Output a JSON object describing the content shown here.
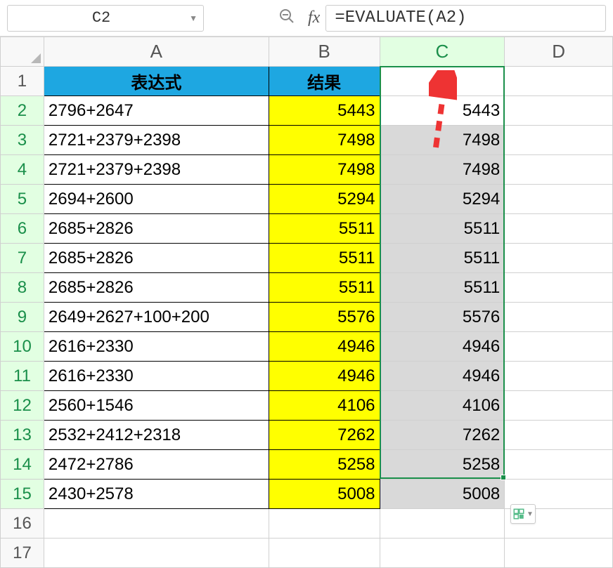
{
  "name_box": {
    "cell_reference": "C2"
  },
  "formula_bar": {
    "formula": "=EVALUATE(A2)"
  },
  "columns": [
    "A",
    "B",
    "C",
    "D"
  ],
  "headers": {
    "expression": "表达式",
    "result": "结果"
  },
  "rows": [
    {
      "n": 2,
      "expr": "2796+2647",
      "result": 5443,
      "c": 5443
    },
    {
      "n": 3,
      "expr": "2721+2379+2398",
      "result": 7498,
      "c": 7498
    },
    {
      "n": 4,
      "expr": "2721+2379+2398",
      "result": 7498,
      "c": 7498
    },
    {
      "n": 5,
      "expr": "2694+2600",
      "result": 5294,
      "c": 5294
    },
    {
      "n": 6,
      "expr": "2685+2826",
      "result": 5511,
      "c": 5511
    },
    {
      "n": 7,
      "expr": "2685+2826",
      "result": 5511,
      "c": 5511
    },
    {
      "n": 8,
      "expr": "2685+2826",
      "result": 5511,
      "c": 5511
    },
    {
      "n": 9,
      "expr": "2649+2627+100+200",
      "result": 5576,
      "c": 5576
    },
    {
      "n": 10,
      "expr": "2616+2330",
      "result": 4946,
      "c": 4946
    },
    {
      "n": 11,
      "expr": "2616+2330",
      "result": 4946,
      "c": 4946
    },
    {
      "n": 12,
      "expr": "2560+1546",
      "result": 4106,
      "c": 4106
    },
    {
      "n": 13,
      "expr": "2532+2412+2318",
      "result": 7262,
      "c": 7262
    },
    {
      "n": 14,
      "expr": "2472+2786",
      "result": 5258,
      "c": 5258
    },
    {
      "n": 15,
      "expr": "2430+2578",
      "result": 5008,
      "c": 5008
    }
  ],
  "extra_rows": [
    16,
    17
  ]
}
